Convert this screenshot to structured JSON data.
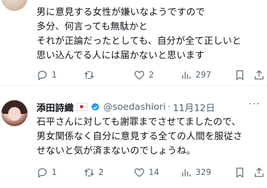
{
  "tweets": [
    {
      "body": "男に意見する女性が嫌いなようですので\n多分、何言っても無駄かと\nそれが正論だったとしても、自分が全て正しいと\n思い込んでる人には届かないと思います",
      "stats": {
        "replies": "1",
        "retweets": "",
        "likes": "2",
        "views": "297"
      }
    },
    {
      "author_name": "添田詩織",
      "handle": "@soedashiori",
      "separator": "·",
      "date": "11月12日",
      "more": "···",
      "body": "石平さんに対しても謝罪までさせてましたので、\n男女関係なく自分に意見する全ての人間を服従さ\nせないと気が済まないのでしょうね。",
      "stats": {
        "replies": "1",
        "retweets": "2",
        "likes": "14",
        "views": "329"
      }
    }
  ],
  "icons": {
    "reply": "reply-icon",
    "retweet": "retweet-icon",
    "like": "heart-icon",
    "views": "views-icon",
    "bookmark": "bookmark-icon",
    "share": "share-icon",
    "verified": "verified-badge-icon",
    "flag": "japan-flag-icon"
  },
  "colors": {
    "verified": "#1d9bf0",
    "muted": "#536471"
  }
}
